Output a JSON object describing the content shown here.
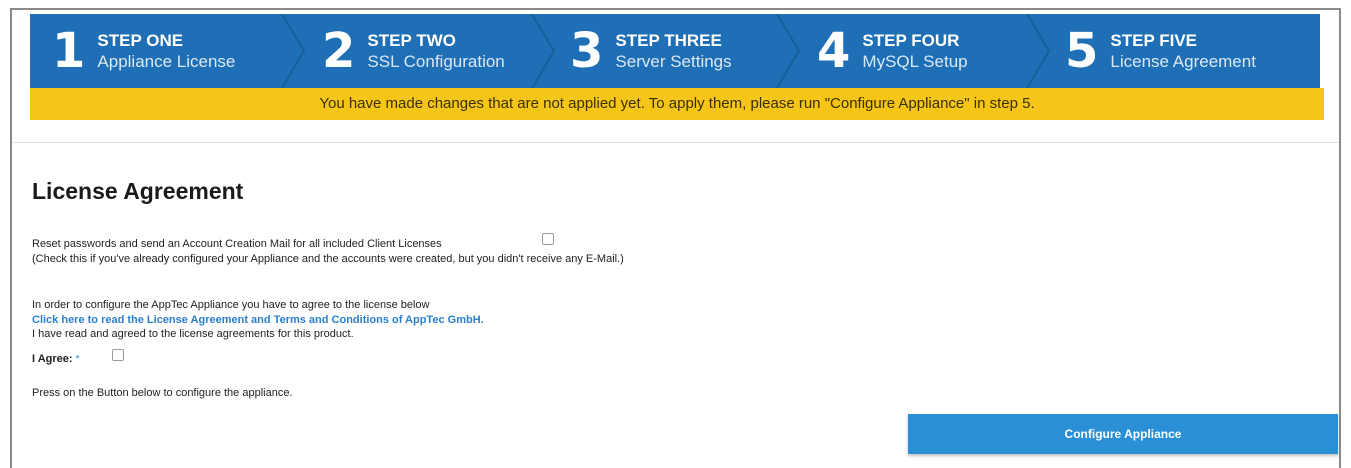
{
  "wizard": {
    "steps": [
      {
        "number": "1",
        "title": "STEP ONE",
        "subtitle": "Appliance License"
      },
      {
        "number": "2",
        "title": "STEP TWO",
        "subtitle": "SSL Configuration"
      },
      {
        "number": "3",
        "title": "STEP THREE",
        "subtitle": "Server Settings"
      },
      {
        "number": "4",
        "title": "STEP FOUR",
        "subtitle": "MySQL Setup"
      },
      {
        "number": "5",
        "title": "STEP FIVE",
        "subtitle": "License Agreement"
      }
    ]
  },
  "warning": {
    "text": "You have made changes that are not applied yet. To apply them, please run \"Configure Appliance\" in step 5."
  },
  "main": {
    "heading": "License Agreement",
    "reset_label": "Reset passwords and send an Account Creation Mail for all included Client Licenses",
    "reset_hint": "(Check this if you've already configured your Appliance and the accounts were created, but you didn't receive any E-Mail.)",
    "intro": "In order to configure the AppTec Appliance you have to agree to the license below",
    "license_link": "Click here to read the License Agreement and Terms and Conditions of AppTec GmbH.",
    "agreed_text": "I have read and agreed to the license agreements for this product.",
    "agree_label": "I Agree:",
    "required_mark": "*",
    "press_text": "Press on the Button below to configure the appliance.",
    "configure_button": "Configure Appliance"
  },
  "colors": {
    "wizard_bg": "#1e6fb5",
    "warning_bg": "#f5c518",
    "link": "#2a7fcf",
    "button_bg": "#2a8fd4"
  }
}
